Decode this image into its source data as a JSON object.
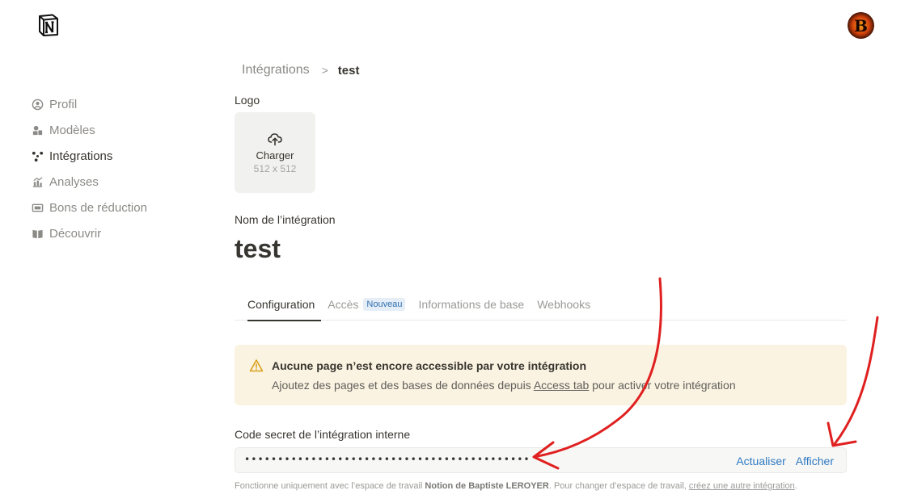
{
  "header": {
    "logo_icon": "notion-logo-icon",
    "avatar_letter": "B"
  },
  "sidebar": {
    "items": [
      {
        "label": "Profil",
        "icon": "profile-icon"
      },
      {
        "label": "Modèles",
        "icon": "templates-icon"
      },
      {
        "label": "Intégrations",
        "icon": "integrations-icon",
        "active": true
      },
      {
        "label": "Analyses",
        "icon": "analytics-icon"
      },
      {
        "label": "Bons de réduction",
        "icon": "coupon-icon"
      },
      {
        "label": "Découvrir",
        "icon": "discover-icon"
      }
    ]
  },
  "breadcrumb": {
    "parent": "Intégrations",
    "separator": ">",
    "current": "test"
  },
  "logo_section": {
    "label": "Logo",
    "upload_label": "Charger",
    "upload_size": "512 x 512"
  },
  "name_section": {
    "label": "Nom de l’intégration",
    "value": "test"
  },
  "tabs": [
    {
      "label": "Configuration",
      "active": true
    },
    {
      "label": "Accès",
      "badge": "Nouveau"
    },
    {
      "label": "Informations de base"
    },
    {
      "label": "Webhooks"
    }
  ],
  "alert": {
    "icon": "warning-icon",
    "title": "Aucune page n’est encore accessible par votre intégration",
    "body_before": "Ajoutez des pages et des bases de données depuis ",
    "body_link": "Access tab",
    "body_after": " pour activer votre intégration"
  },
  "secret": {
    "label": "Code secret de l’intégration interne",
    "masked_value": "•••••••••••••••••••••••••••••••••••••••••••",
    "refresh_label": "Actualiser",
    "show_label": "Afficher"
  },
  "footnote": {
    "before": "Fonctionne uniquement avec l’espace de travail ",
    "workspace": "Notion de Baptiste LEROYER",
    "middle": ". Pour changer d’espace de travail, ",
    "link": "créez une autre intégration",
    "after": "."
  },
  "colors": {
    "accent_link": "#2f7ac3",
    "alert_bg": "#fbf3e1",
    "annotation_red": "#e02020"
  }
}
